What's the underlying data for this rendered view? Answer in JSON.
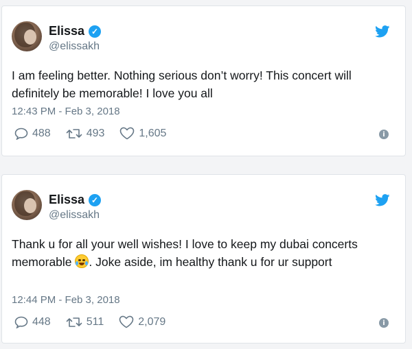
{
  "colors": {
    "brand_blue": "#1da1f2",
    "text_primary": "#14171a",
    "text_secondary": "#657786"
  },
  "tweets": [
    {
      "author_name": "Elissa",
      "handle": "@elissakh",
      "text": "I am feeling better. Nothing serious don’t worry! This concert will definitely be memorable! I love you all",
      "timestamp": "12:43 PM - Feb 3, 2018",
      "replies": "488",
      "retweets": "493",
      "likes": "1,605",
      "icons": [
        "avatar",
        "verified-badge-icon",
        "twitter-bird-icon",
        "reply-icon",
        "retweet-icon",
        "heart-icon",
        "info-icon"
      ]
    },
    {
      "author_name": "Elissa",
      "handle": "@elissakh",
      "text_before_emoji": "Thank u for all your well wishes! I love to keep my dubai concerts memorable ",
      "emoji": "face-with-tears-of-joy",
      "text_after_emoji": ". Joke aside, im healthy thank u for ur support",
      "timestamp": "12:44 PM - Feb 3, 2018",
      "replies": "448",
      "retweets": "511",
      "likes": "2,079",
      "icons": [
        "avatar",
        "verified-badge-icon",
        "twitter-bird-icon",
        "reply-icon",
        "retweet-icon",
        "heart-icon",
        "info-icon"
      ]
    }
  ]
}
